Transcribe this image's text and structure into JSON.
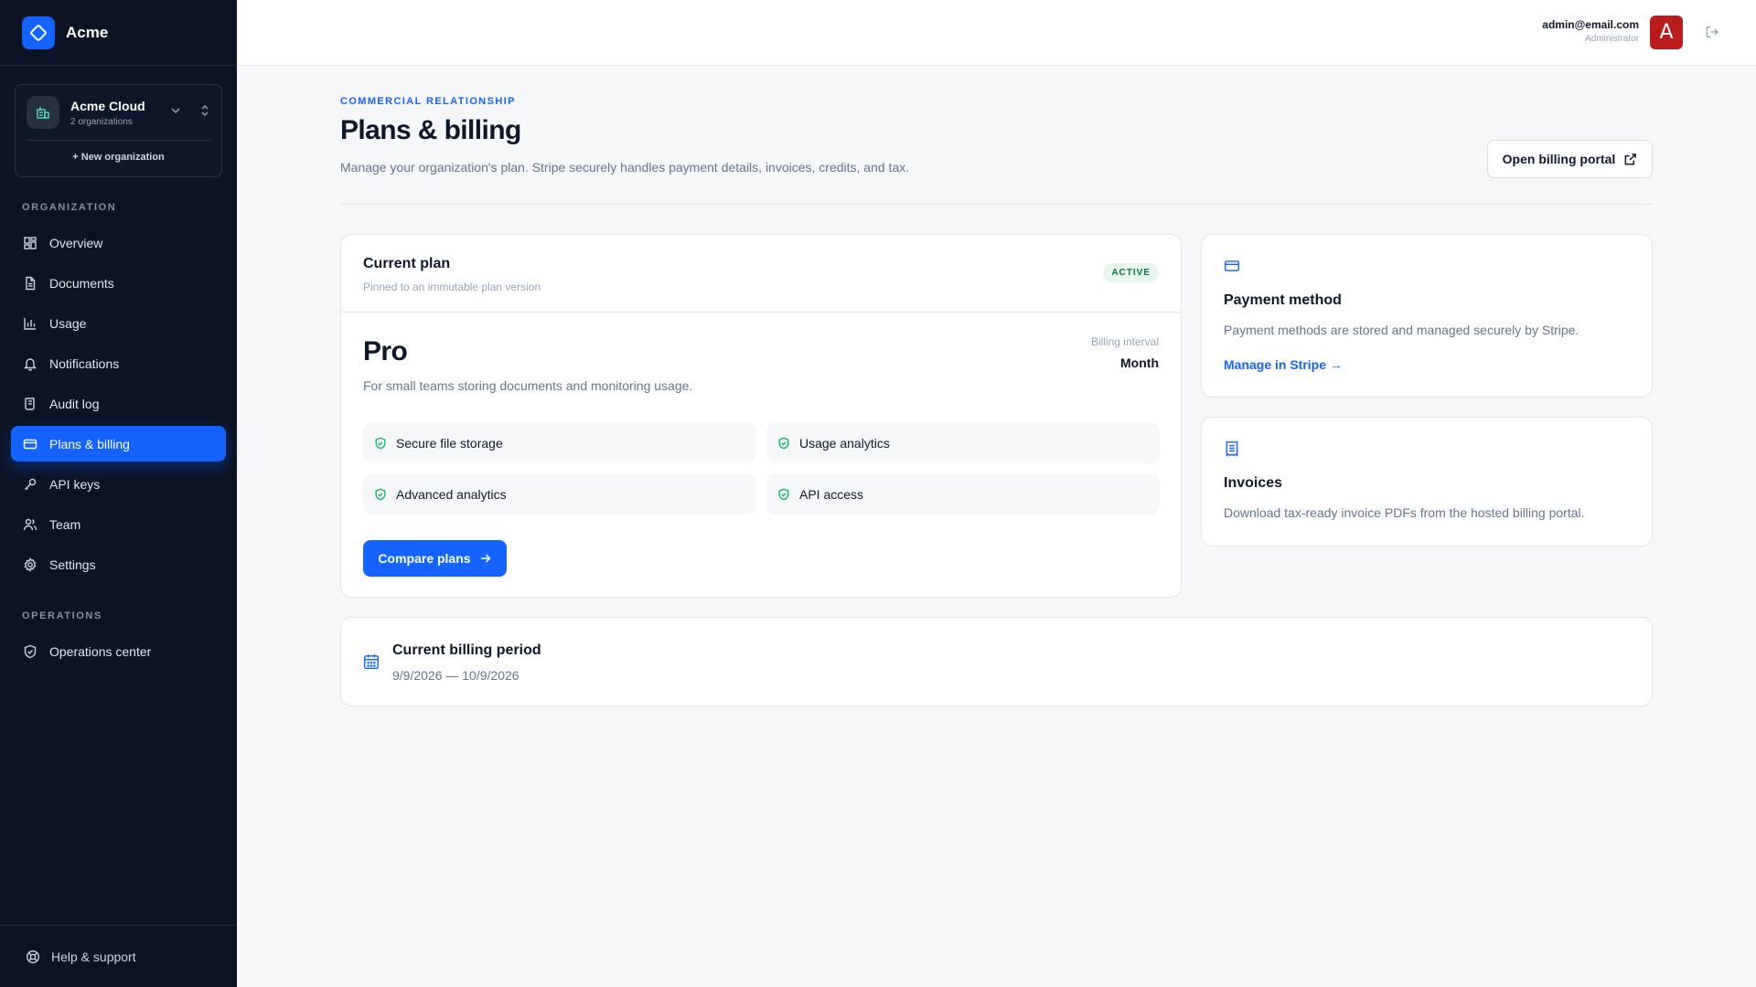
{
  "brand": {
    "name": "Acme"
  },
  "org": {
    "name": "Acme Cloud",
    "count": "2 organizations",
    "new_label": "+ New organization"
  },
  "nav": {
    "section_org": "ORGANIZATION",
    "section_ops": "OPERATIONS",
    "items": [
      {
        "label": "Overview",
        "icon": "grid-icon"
      },
      {
        "label": "Documents",
        "icon": "document-icon"
      },
      {
        "label": "Usage",
        "icon": "bar-chart-icon"
      },
      {
        "label": "Notifications",
        "icon": "bell-icon"
      },
      {
        "label": "Audit log",
        "icon": "scroll-icon"
      },
      {
        "label": "Plans & billing",
        "icon": "credit-card-icon",
        "active": true
      },
      {
        "label": "API keys",
        "icon": "key-icon"
      },
      {
        "label": "Team",
        "icon": "users-icon"
      },
      {
        "label": "Settings",
        "icon": "gear-icon"
      }
    ],
    "ops_items": [
      {
        "label": "Operations center",
        "icon": "shield-icon"
      }
    ],
    "help": "Help & support"
  },
  "user": {
    "email": "admin@email.com",
    "role": "Administrator",
    "initial": "A"
  },
  "page": {
    "eyebrow": "COMMERCIAL RELATIONSHIP",
    "title": "Plans & billing",
    "description": "Manage your organization's plan. Stripe securely handles payment details, invoices, credits, and tax.",
    "portal_button": "Open billing portal"
  },
  "plan": {
    "header_title": "Current plan",
    "header_sub": "Pinned to an immutable plan version",
    "status": "ACTIVE",
    "name": "Pro",
    "description": "For small teams storing documents and monitoring usage.",
    "interval_label": "Billing interval",
    "interval_value": "Month",
    "features": [
      "Secure file storage",
      "Usage analytics",
      "Advanced analytics",
      "API access"
    ],
    "compare_button": "Compare plans"
  },
  "payment": {
    "title": "Payment method",
    "description": "Payment methods are stored and managed securely by Stripe.",
    "link": "Manage in Stripe →"
  },
  "invoices": {
    "title": "Invoices",
    "description": "Download tax-ready invoice PDFs from the hosted billing portal."
  },
  "period": {
    "title": "Current billing period",
    "value": "9/9/2026 — 10/9/2026"
  },
  "colors": {
    "accent": "#1463ff",
    "sidebar": "#0b1324",
    "success": "#12b76a",
    "avatar": "#b81c1c"
  }
}
